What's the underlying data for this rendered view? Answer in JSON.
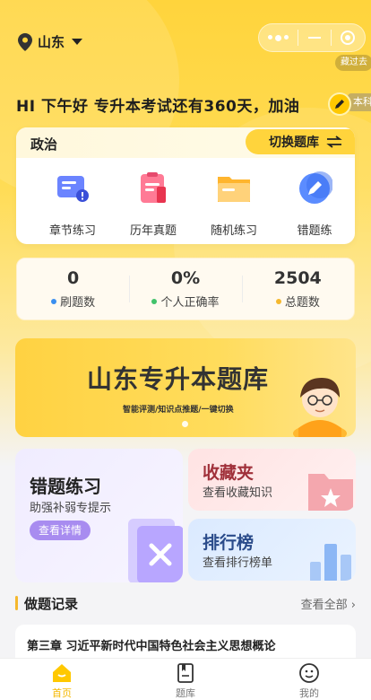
{
  "header": {
    "location": "山东",
    "tag_chip": "藏过去",
    "greeting": "HI 下午好 专升本考试还有360天，加油",
    "side_tag": "本科"
  },
  "subject_card": {
    "subject": "政治",
    "switch_label": "切换题库",
    "tools": [
      {
        "label": "章节练习",
        "icon": "chapter-icon"
      },
      {
        "label": "历年真题",
        "icon": "past-exam-icon"
      },
      {
        "label": "随机练习",
        "icon": "random-practice-icon"
      },
      {
        "label": "错题练",
        "icon": "mistake-icon"
      }
    ]
  },
  "stats": [
    {
      "value": "0",
      "label": "刷题数",
      "color": "#3a8ff0"
    },
    {
      "value": "0%",
      "label": "个人正确率",
      "color": "#41c26b"
    },
    {
      "value": "2504",
      "label": "总题数",
      "color": "#f5b82e"
    }
  ],
  "banner": {
    "title": "山东专升本题库",
    "subtitle": "智能评测/知识点推题/一键切换"
  },
  "features": {
    "mistakes": {
      "title": "错题练习",
      "desc": "助强补弱专提示",
      "button": "查看详情"
    },
    "favorites": {
      "title": "收藏夹",
      "desc": "查看收藏知识"
    },
    "ranking": {
      "title": "排行榜",
      "desc": "查看排行榜单"
    }
  },
  "records": {
    "title": "做题记录",
    "view_all": "查看全部 ›",
    "first_item": "第三章  习近平新时代中国特色社会主义思想概论"
  },
  "tabbar": [
    {
      "label": "首页",
      "icon": "home-icon",
      "active": true
    },
    {
      "label": "题库",
      "icon": "question-bank-icon",
      "active": false
    },
    {
      "label": "我的",
      "icon": "profile-icon",
      "active": false
    }
  ],
  "colors": {
    "brand": "#ffd43c",
    "active_tab": "#f5b800"
  }
}
